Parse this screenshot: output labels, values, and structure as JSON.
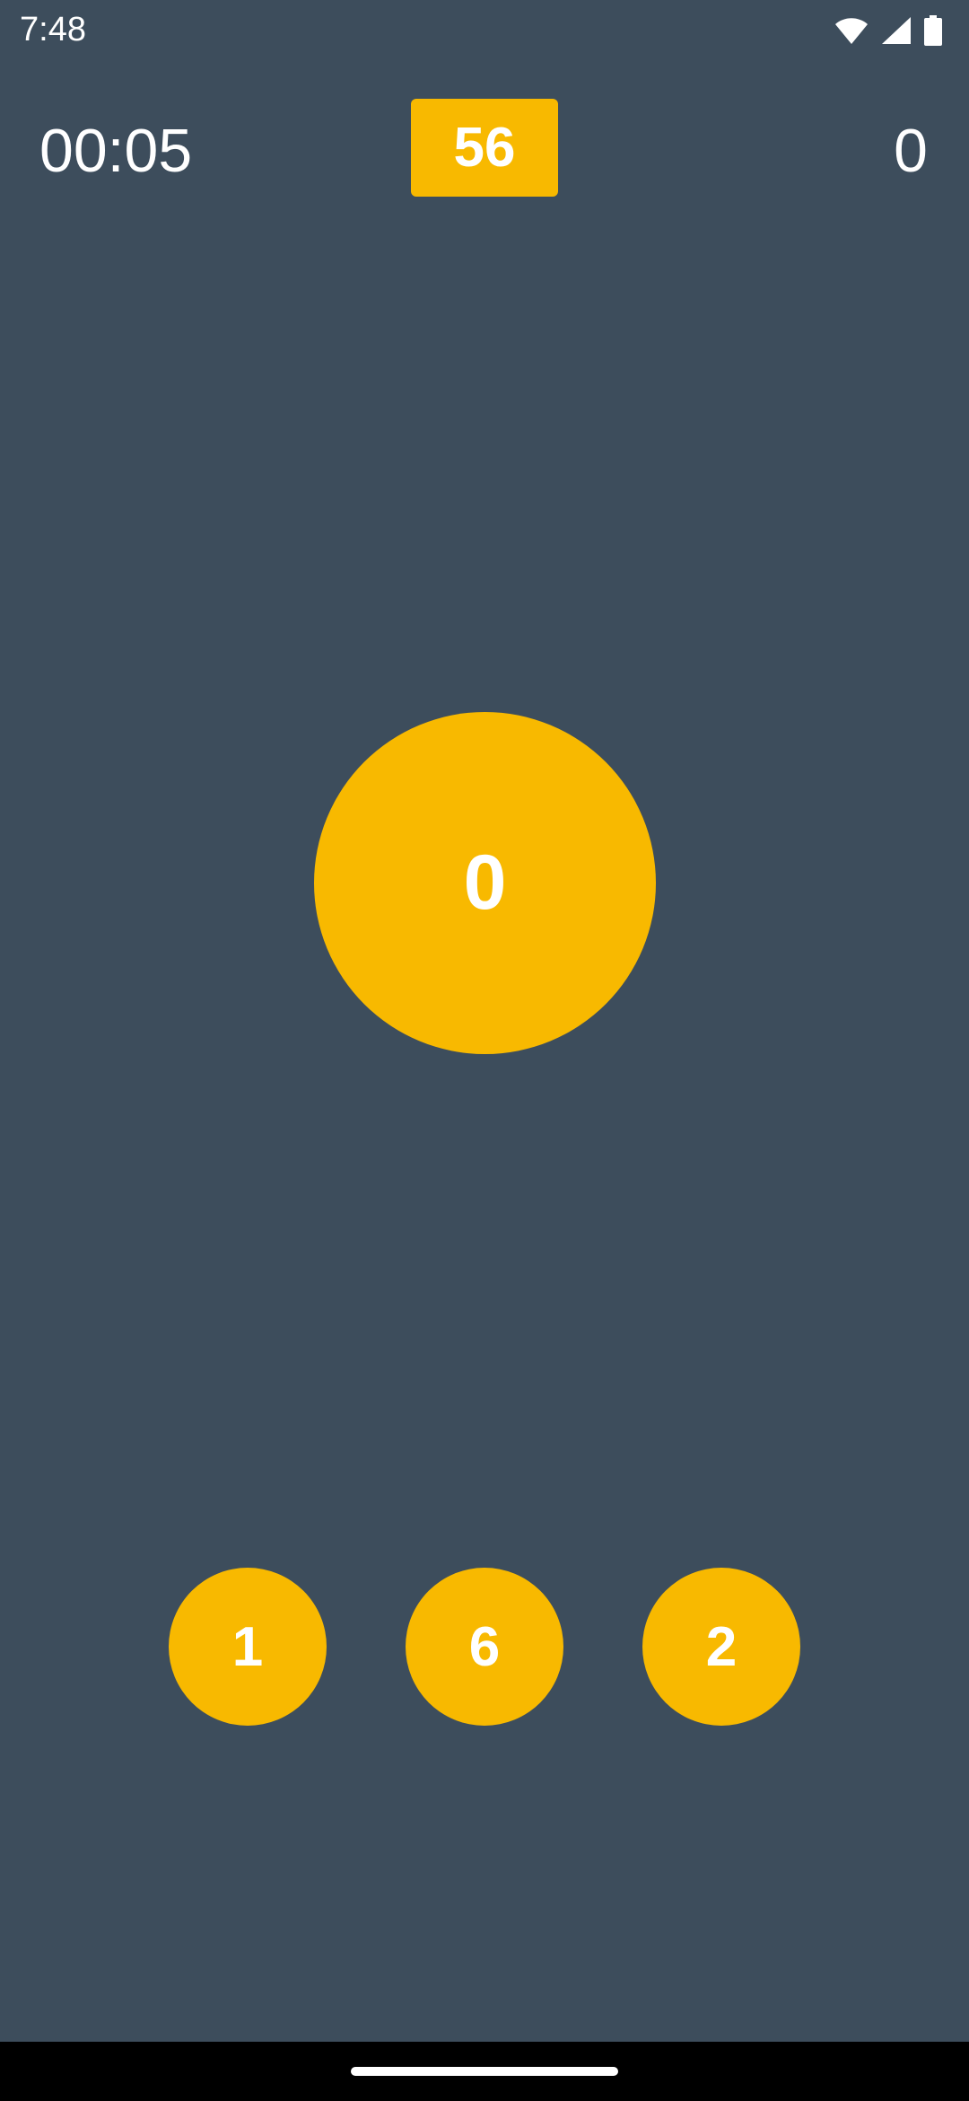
{
  "status_bar": {
    "time": "7:48",
    "icons": [
      "wifi-icon",
      "cellular-signal-icon",
      "battery-icon"
    ]
  },
  "game": {
    "timer": "00:05",
    "target": "56",
    "score": "0",
    "current_value": "0",
    "options": [
      "1",
      "6",
      "2"
    ]
  },
  "colors": {
    "background": "#3d4d5c",
    "accent": "#f8b900",
    "text": "#ffffff"
  }
}
